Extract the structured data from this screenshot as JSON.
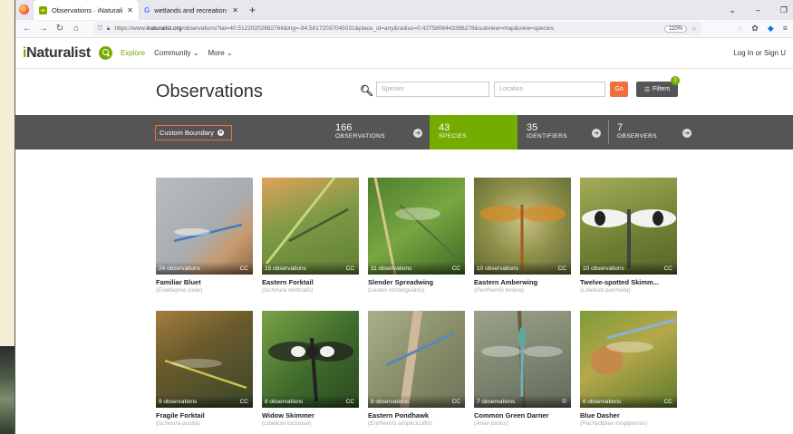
{
  "browser": {
    "tabs": [
      {
        "title": "Observations · iNaturalist",
        "active": true
      },
      {
        "title": "wetlands and recreation - Goo",
        "active": false
      }
    ],
    "new_tab": "+",
    "url_prefix": "https://www.",
    "url_domain": "inaturalist.org",
    "url_rest": "/observations?lat=40.51220202692766&lng=-84.58172037045031&place_id=any&radius=0.4275806443386278&subview=map&view=species",
    "zoom": "110%",
    "window_controls": [
      "⌄",
      "–",
      "❐"
    ]
  },
  "site": {
    "logo_prefix": "i",
    "logo_rest": "Naturalist",
    "nav": [
      {
        "label": "Explore",
        "active": true
      },
      {
        "label": "Community ⌄",
        "active": false
      },
      {
        "label": "More ⌄",
        "active": false
      }
    ],
    "login": "Log In or Sign U"
  },
  "page": {
    "title": "Observations",
    "species_placeholder": "Species",
    "location_placeholder": "Location",
    "go_label": "Go",
    "filters_label": "Filters",
    "filters_count": "3"
  },
  "stats": {
    "custom_boundary": "Custom Boundary",
    "items": [
      {
        "num": "166",
        "label": "OBSERVATIONS",
        "selected": false
      },
      {
        "num": "43",
        "label": "SPECIES",
        "selected": true
      },
      {
        "num": "35",
        "label": "IDENTIFIERS",
        "selected": false
      },
      {
        "num": "7",
        "label": "OBSERVERS",
        "selected": false
      }
    ]
  },
  "species": [
    {
      "count": "24 observations",
      "license": "CC",
      "name": "Familiar Bluet",
      "sci": "Enallagma civile"
    },
    {
      "count": "15 observations",
      "license": "CC",
      "name": "Eastern Forktail",
      "sci": "Ischnura verticalis"
    },
    {
      "count": "11 observations",
      "license": "CC",
      "name": "Slender Spreadwing",
      "sci": "Lestes rectangularis"
    },
    {
      "count": "10 observations",
      "license": "CC",
      "name": "Eastern Amberwing",
      "sci": "Perithemis tenera"
    },
    {
      "count": "10 observations",
      "license": "CC",
      "name": "Twelve-spotted Skimm...",
      "sci": "Libellula pulchella"
    },
    {
      "count": "9 observations",
      "license": "CC",
      "name": "Fragile Forktail",
      "sci": "Ischnura posita"
    },
    {
      "count": "8 observations",
      "license": "CC",
      "name": "Widow Skimmer",
      "sci": "Libellula luctuosa"
    },
    {
      "count": "8 observations",
      "license": "CC",
      "name": "Eastern Pondhawk",
      "sci": "Erythemis simplicicollis"
    },
    {
      "count": "7 observations",
      "license": "©",
      "name": "Common Green Darner",
      "sci": "Anax junius"
    },
    {
      "count": "6 observations",
      "license": "CC",
      "name": "Blue Dasher",
      "sci": "Pachydiplax longipennis"
    }
  ],
  "colors": {
    "brand_green": "#74ac00",
    "accent_orange": "#f16f3a",
    "stats_bar": "#555555"
  }
}
